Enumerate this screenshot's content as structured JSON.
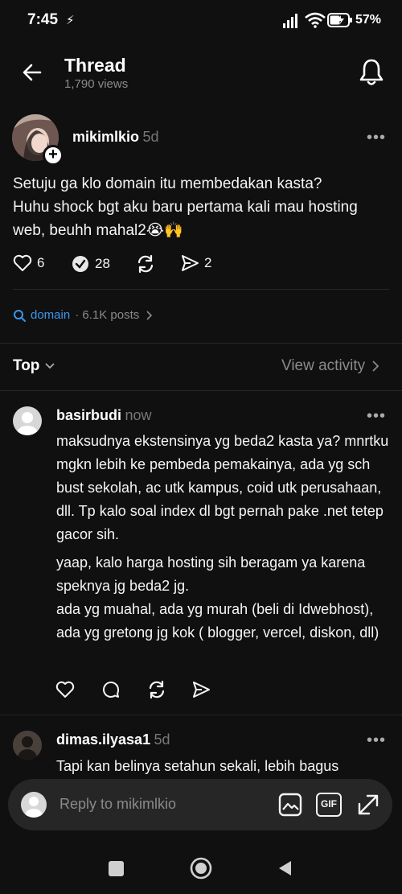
{
  "status": {
    "time": "7:45",
    "battery": "57%"
  },
  "header": {
    "title": "Thread",
    "views": "1,790 views"
  },
  "post": {
    "username": "mikimlkio",
    "ago": "5d",
    "text": "Setuju ga klo domain itu membedakan kasta?\nHuhu shock bgt aku baru pertama kali mau hosting web, beuhh mahal2😭🙌",
    "likes": "6",
    "replies": "28",
    "shares": "2"
  },
  "topic": {
    "name": "domain",
    "count": "· 6.1K posts"
  },
  "sort": {
    "label": "Top",
    "view_activity": "View activity"
  },
  "reply1": {
    "username": "basirbudi",
    "ago": "now",
    "para1": "maksudnya ekstensinya yg beda2 kasta ya? mnrtku mgkn lebih ke pembeda pemakainya, ada yg sch bust sekolah, ac utk kampus, coid utk perusahaan, dll. Tp kalo soal index dl bgt pernah pake .net tetep gacor sih.",
    "para2": "yaap, kalo harga hosting sih beragam ya karena speknya jg beda2 jg.\nada yg muahal, ada yg murah (beli di Idwebhost), ada yg gretong jg kok ( blogger, vercel, diskon, dll)"
  },
  "reply2": {
    "username": "dimas.ilyasa1",
    "ago": "5d",
    "text": "Tapi kan belinya setahun sekali, lebih bagus"
  },
  "composer": {
    "placeholder": "Reply to mikimlkio",
    "gif_label": "GIF"
  },
  "colors": {
    "background": "#101010",
    "link": "#3897f0",
    "muted": "#8a8a8a"
  }
}
